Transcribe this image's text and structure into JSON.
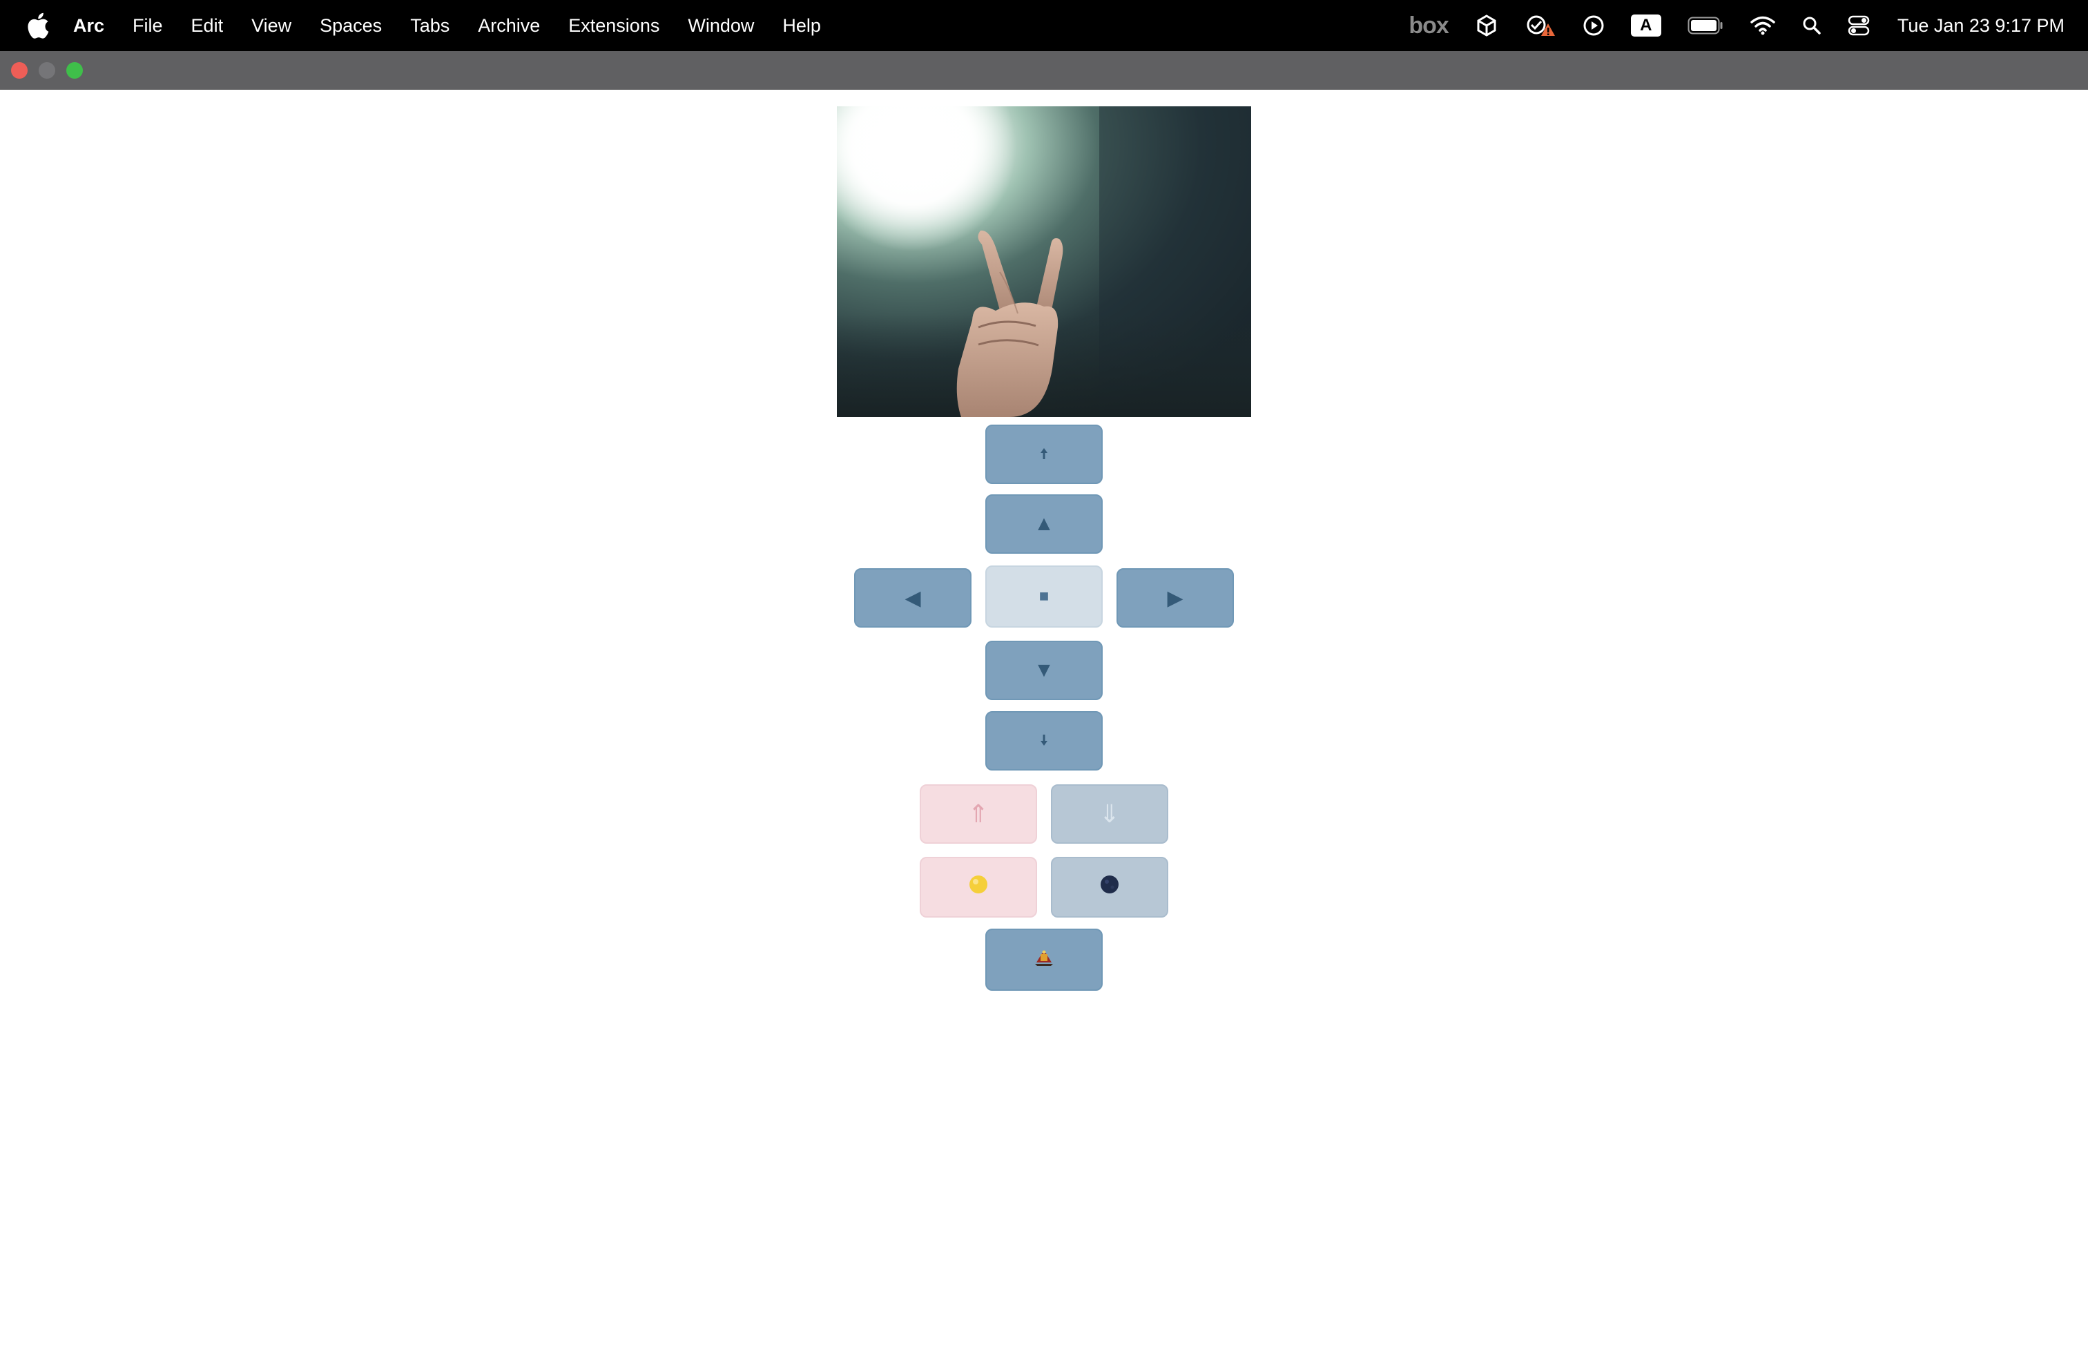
{
  "menubar": {
    "app_name": "Arc",
    "menus": [
      "File",
      "Edit",
      "View",
      "Spaces",
      "Tabs",
      "Archive",
      "Extensions",
      "Window",
      "Help"
    ],
    "status": {
      "box_logo": "box",
      "input_source": "A",
      "clock": "Tue Jan 23  9:17 PM"
    }
  },
  "window": {
    "traffic_lights": {
      "close_color": "#ee5e57",
      "minimize_color": "#757578",
      "maximize_color": "#3fbf4a"
    }
  },
  "controls": {
    "buttons": [
      {
        "id": "up-small",
        "icon": "small-up-arrow-icon"
      },
      {
        "id": "up",
        "icon": "triangle-up-icon",
        "glyph": "▲"
      },
      {
        "id": "left",
        "icon": "triangle-left-icon",
        "glyph": "◀"
      },
      {
        "id": "stop",
        "icon": "square-stop-icon",
        "glyph": "■"
      },
      {
        "id": "right",
        "icon": "triangle-right-icon",
        "glyph": "▶"
      },
      {
        "id": "down",
        "icon": "triangle-down-icon",
        "glyph": "▼"
      },
      {
        "id": "down-small",
        "icon": "small-down-arrow-icon"
      },
      {
        "id": "double-up",
        "icon": "double-arrow-up-icon",
        "glyph": "⇑"
      },
      {
        "id": "double-down",
        "icon": "double-arrow-down-icon",
        "glyph": "⇓"
      },
      {
        "id": "sun",
        "icon": "sun-icon"
      },
      {
        "id": "moon",
        "icon": "moon-icon"
      },
      {
        "id": "rocket",
        "icon": "rocket-icon"
      }
    ]
  },
  "colors": {
    "button_blue": "#7fa1bd",
    "button_stop": "#d3dee7",
    "button_pink": "#f6dde1",
    "button_grey": "#b7c7d5",
    "menubar": "#000000",
    "titlebar": "#606062"
  }
}
